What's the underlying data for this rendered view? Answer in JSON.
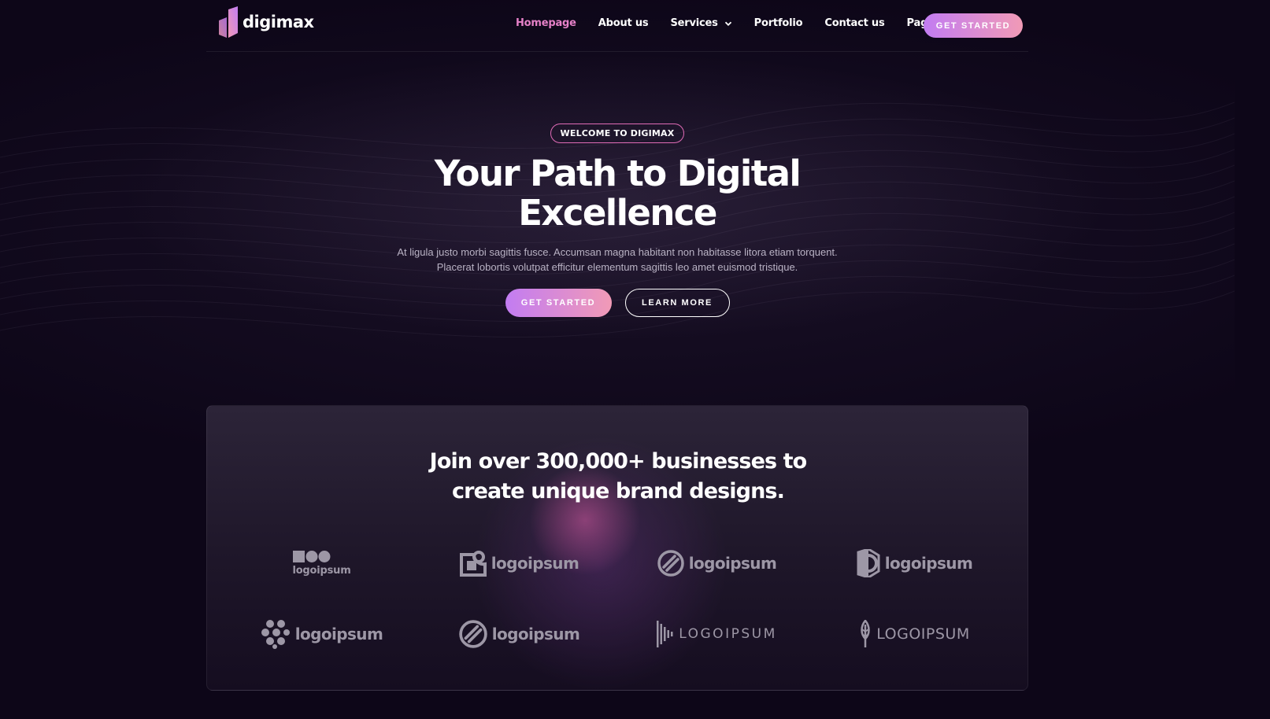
{
  "header": {
    "logo_text": "digimax",
    "nav": [
      {
        "label": "Homepage",
        "active": true,
        "dropdown": false
      },
      {
        "label": "About us",
        "active": false,
        "dropdown": false
      },
      {
        "label": "Services",
        "active": false,
        "dropdown": true
      },
      {
        "label": "Portfolio",
        "active": false,
        "dropdown": false
      },
      {
        "label": "Contact us",
        "active": false,
        "dropdown": false
      },
      {
        "label": "Pages",
        "active": false,
        "dropdown": true
      }
    ],
    "cta_label": "GET STARTED"
  },
  "hero": {
    "badge": "WELCOME TO DIGIMAX",
    "title_line1": "Your Path to Digital",
    "title_line2": "Excellence",
    "description": "At ligula justo morbi sagittis fusce. Accumsan magna habitant non habitasse litora etiam torquent. Placerat lobortis volutpat efficitur elementum sagittis leo amet euismod tristique.",
    "primary_button": "GET STARTED",
    "secondary_button": "LEARN MORE"
  },
  "clients": {
    "title_line1": "Join over 300,000+ businesses to",
    "title_line2": "create unique brand designs.",
    "logos": [
      {
        "text": "logoipsum",
        "icon": "dots-logo-icon"
      },
      {
        "text": "logoipsum",
        "icon": "square-q-logo-icon"
      },
      {
        "text": "logoipsum",
        "icon": "circle-stripe-logo-icon"
      },
      {
        "text": "logoipsum",
        "icon": "half-hex-logo-icon"
      },
      {
        "text": "logoipsum",
        "icon": "cluster-logo-icon"
      },
      {
        "text": "logoipsum",
        "icon": "circle-stripe-logo-icon"
      },
      {
        "text": "LOGOIPSUM",
        "icon": "bars-logo-icon"
      },
      {
        "text": "LOGOIPSUM",
        "icon": "leaf-logo-icon"
      }
    ]
  },
  "colors": {
    "background": "#0d0618",
    "accent_pink": "#e681c8",
    "gradient_start": "#c27cf2",
    "gradient_end": "#f19ab6",
    "logo_gray": "#9d97a6"
  }
}
